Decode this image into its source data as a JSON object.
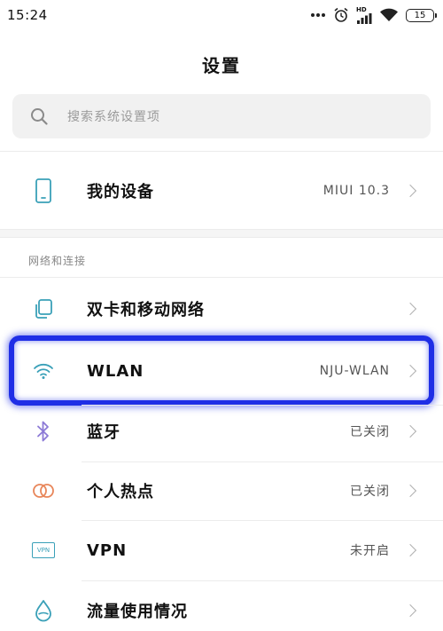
{
  "status_bar": {
    "time": "15:24",
    "hd_label": "HD",
    "battery": "15"
  },
  "title": "设置",
  "search": {
    "placeholder": "搜索系统设置项"
  },
  "device_row": {
    "label": "我的设备",
    "value": "MIUI 10.3"
  },
  "network_section": {
    "header": "网络和连接",
    "items": [
      {
        "label": "双卡和移动网络",
        "value": "",
        "icon": "sim-card-icon"
      },
      {
        "label": "WLAN",
        "value": "NJU-WLAN",
        "icon": "wifi-icon"
      },
      {
        "label": "蓝牙",
        "value": "已关闭",
        "icon": "bluetooth-icon"
      },
      {
        "label": "个人热点",
        "value": "已关闭",
        "icon": "hotspot-icon"
      },
      {
        "label": "VPN",
        "value": "未开启",
        "icon": "vpn-icon",
        "icon_text": "VPN"
      },
      {
        "label": "流量使用情况",
        "value": "",
        "icon": "data-usage-icon"
      }
    ]
  },
  "colors": {
    "highlight": "#1f2ee6",
    "icon_teal": "#3aa0b8",
    "icon_bluetooth": "#8c7ad6",
    "icon_hotspot": "#e8865a"
  }
}
